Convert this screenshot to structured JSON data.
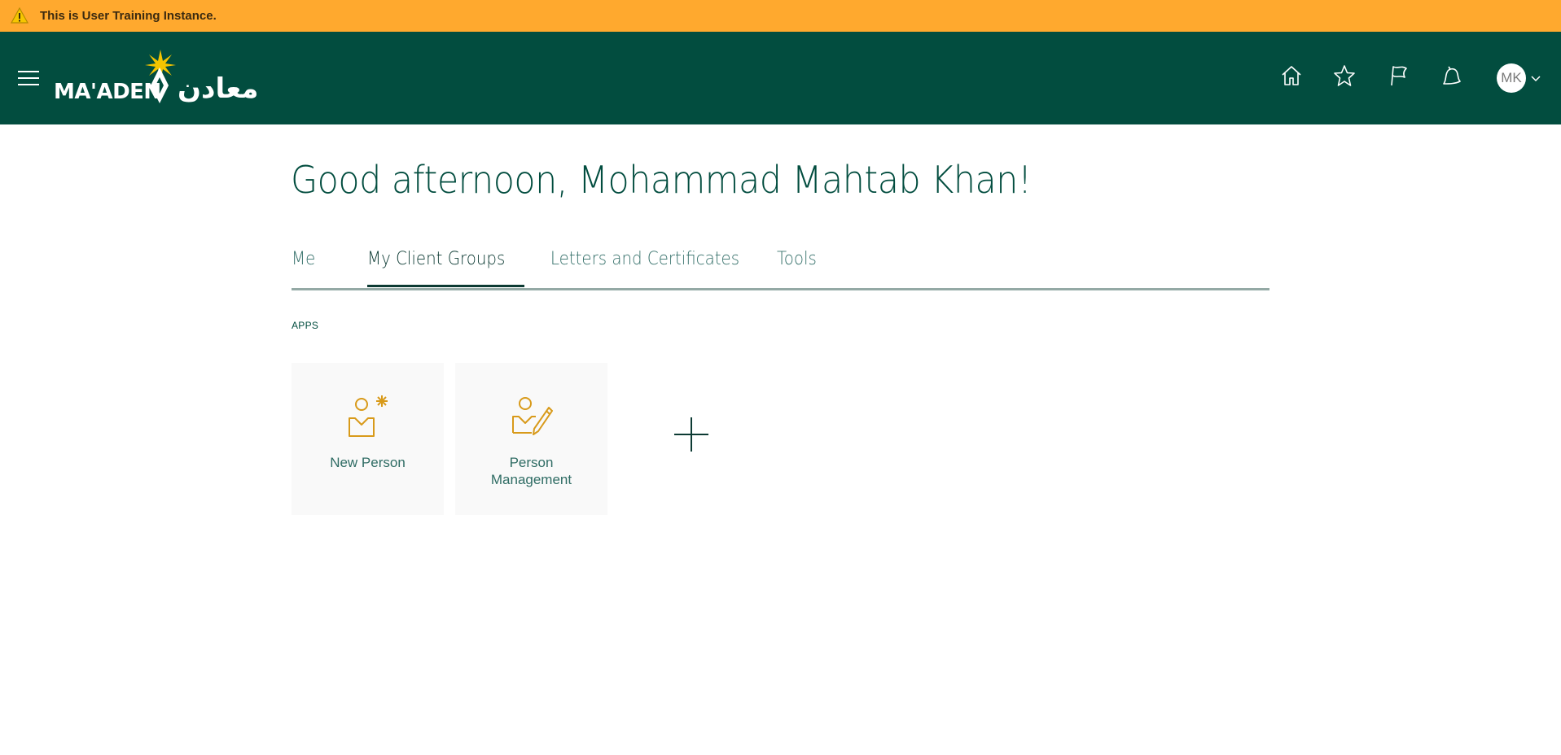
{
  "banner": {
    "icon": "warning-icon",
    "text": "This is User Training Instance."
  },
  "header": {
    "menu_icon": "hamburger-menu-icon",
    "logo": {
      "text_en": "MA'ADEN",
      "text_ar": "معادن"
    },
    "icons": [
      "home-icon",
      "star-icon",
      "flag-icon",
      "bell-icon"
    ],
    "avatar_initials": "MK"
  },
  "greeting": "Good afternoon, Mohammad Mahtab Khan!",
  "tabs": [
    {
      "label": "Me",
      "active": false
    },
    {
      "label": "My Client Groups",
      "active": true
    },
    {
      "label": "Letters and Certificates",
      "active": false
    },
    {
      "label": "Tools",
      "active": false
    }
  ],
  "apps_label": "APPS",
  "apps": [
    {
      "label": "New Person",
      "icon": "new-person-icon"
    },
    {
      "label_line1": "Person",
      "label_line2": "Management",
      "icon": "person-management-icon"
    }
  ],
  "add_icon": "plus-icon",
  "colors": {
    "banner": "#ffa92e",
    "header": "#024d3f",
    "accent": "#d89a1a",
    "text": "#024d3f"
  }
}
